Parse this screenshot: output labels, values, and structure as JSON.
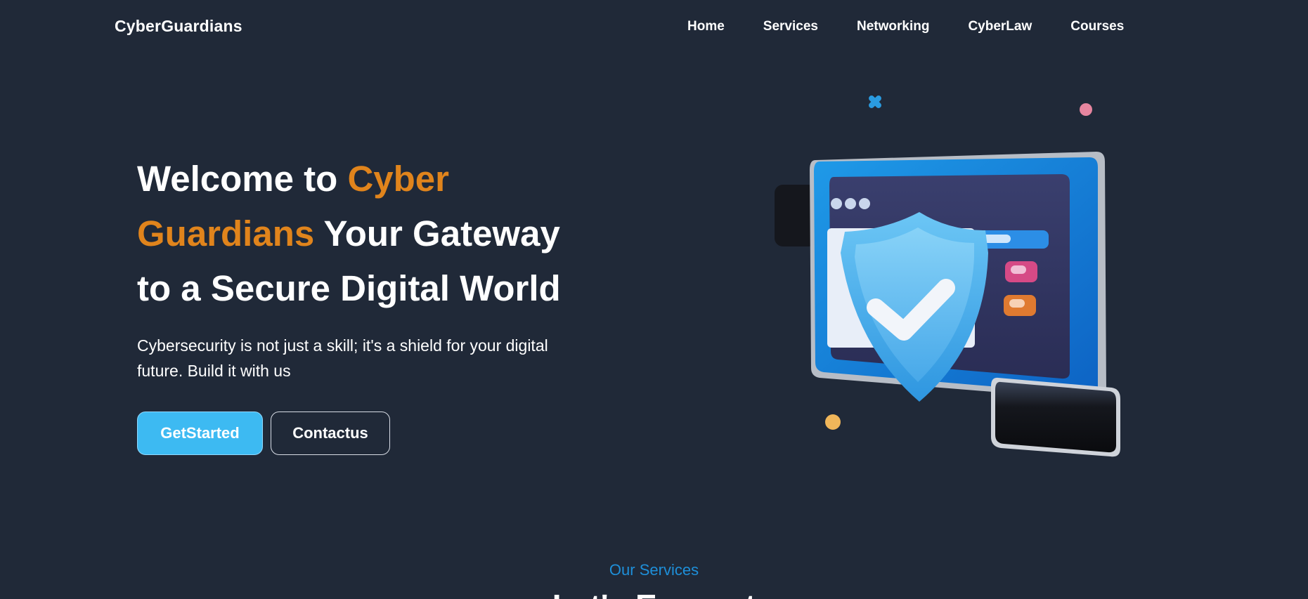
{
  "brand": {
    "name": "CyberGuardians"
  },
  "nav": {
    "items": [
      {
        "label": "Home"
      },
      {
        "label": "Services"
      },
      {
        "label": "Networking"
      },
      {
        "label": "CyberLaw"
      },
      {
        "label": "Courses"
      }
    ]
  },
  "hero": {
    "title_prefix": "Welcome to ",
    "title_accent": "Cyber Guardians",
    "title_suffix": " Your Gateway to a Secure Digital World",
    "subtitle": "Cybersecurity is not just a skill; it's a shield for your digital future. Build it with us",
    "primary_button": "GetStarted",
    "secondary_button": "Contactus"
  },
  "illustration": {
    "icon": "shield-check-icon"
  },
  "services": {
    "label": "Our Services",
    "heading": "Let's Encrypt"
  },
  "colors": {
    "background": "#202938",
    "accent": "#e0841c",
    "primary_button": "#3dbaf2",
    "services_label": "#1e8fd9"
  }
}
